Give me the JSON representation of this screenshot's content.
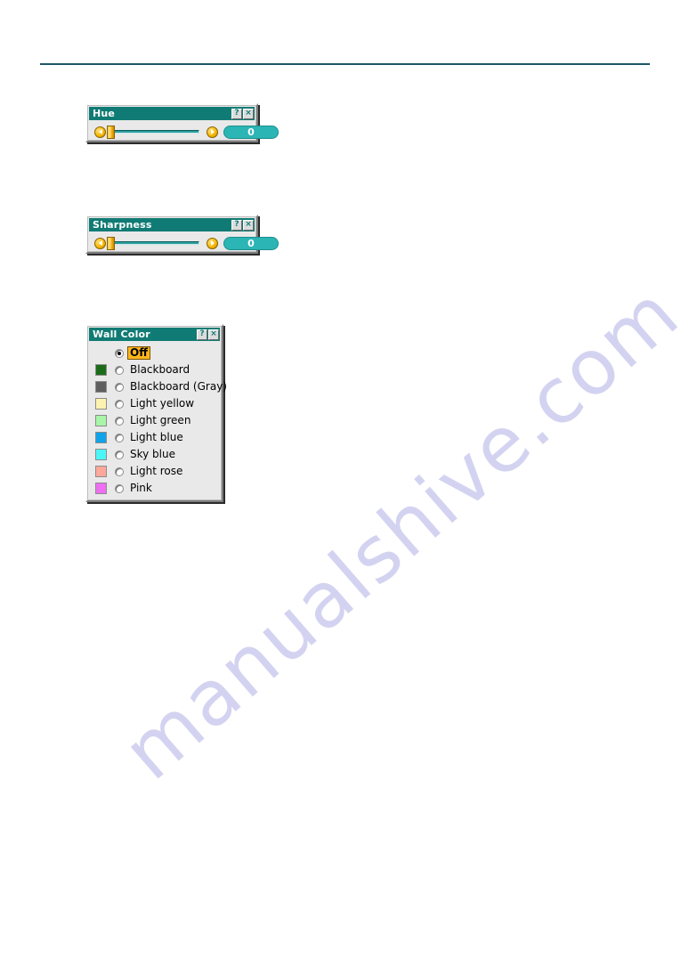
{
  "page": {
    "background_color": "#ffffff",
    "rule_color": "#1c5668",
    "watermark_text": "manualshive.com",
    "watermark_color": "#ccccef"
  },
  "theme": {
    "titlebar_color": "#107b74",
    "dialog_face": "#e9e9e9",
    "track_color": "#2e9e9e",
    "pill_color": "#2bb5b5",
    "thumb_color": "#f0a800",
    "highlight_color": "#ffb61e"
  },
  "dialogs": [
    {
      "id": "hue",
      "title": "Hue",
      "help_button": "?",
      "close_button": "×",
      "decrease_arrow": "left-arrow",
      "increase_arrow": "right-arrow",
      "value": "0"
    },
    {
      "id": "sharpness",
      "title": "Sharpness",
      "help_button": "?",
      "close_button": "×",
      "decrease_arrow": "left-arrow",
      "increase_arrow": "right-arrow",
      "value": "0"
    }
  ],
  "wall_color": {
    "title": "Wall Color",
    "help_button": "?",
    "close_button": "×",
    "selected": "Off",
    "options": [
      {
        "label": "Off",
        "swatch": null,
        "selected": true
      },
      {
        "label": "Blackboard",
        "swatch": "#1b6b1b",
        "selected": false
      },
      {
        "label": "Blackboard (Gray)",
        "swatch": "#5e5e5e",
        "selected": false
      },
      {
        "label": "Light yellow",
        "swatch": "#fdf3b0",
        "selected": false
      },
      {
        "label": "Light green",
        "swatch": "#a8f5a8",
        "selected": false
      },
      {
        "label": "Light blue",
        "swatch": "#11a3ea",
        "selected": false
      },
      {
        "label": "Sky blue",
        "swatch": "#4df6f6",
        "selected": false
      },
      {
        "label": "Light rose",
        "swatch": "#ffa79a",
        "selected": false
      },
      {
        "label": "Pink",
        "swatch": "#ee6ff2",
        "selected": false
      }
    ]
  }
}
